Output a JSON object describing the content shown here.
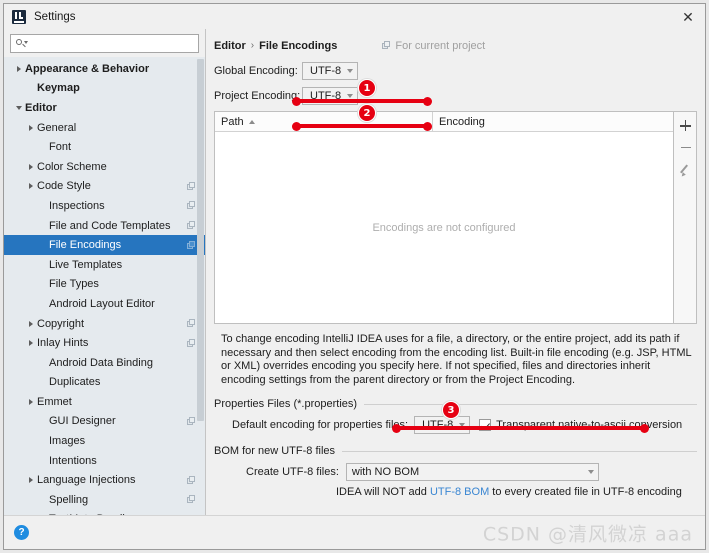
{
  "window": {
    "title": "Settings",
    "app_icon": "intellij-idea-icon",
    "close_label": "✕"
  },
  "sidebar": {
    "search": {
      "placeholder": "",
      "value": "",
      "icon": "search-icon"
    },
    "items": [
      {
        "label": "Appearance & Behavior",
        "arrow": "right",
        "bold": true,
        "indent": 0,
        "project": false,
        "selected": false
      },
      {
        "label": "Keymap",
        "arrow": "none",
        "bold": true,
        "indent": 1,
        "project": false,
        "selected": false
      },
      {
        "label": "Editor",
        "arrow": "down",
        "bold": true,
        "indent": 0,
        "project": false,
        "selected": false
      },
      {
        "label": "General",
        "arrow": "right",
        "bold": false,
        "indent": 1,
        "project": false,
        "selected": false
      },
      {
        "label": "Font",
        "arrow": "none",
        "bold": false,
        "indent": 2,
        "project": false,
        "selected": false
      },
      {
        "label": "Color Scheme",
        "arrow": "right",
        "bold": false,
        "indent": 1,
        "project": false,
        "selected": false
      },
      {
        "label": "Code Style",
        "arrow": "right",
        "bold": false,
        "indent": 1,
        "project": true,
        "selected": false
      },
      {
        "label": "Inspections",
        "arrow": "none",
        "bold": false,
        "indent": 2,
        "project": true,
        "selected": false
      },
      {
        "label": "File and Code Templates",
        "arrow": "none",
        "bold": false,
        "indent": 2,
        "project": true,
        "selected": false
      },
      {
        "label": "File Encodings",
        "arrow": "none",
        "bold": false,
        "indent": 2,
        "project": true,
        "selected": true
      },
      {
        "label": "Live Templates",
        "arrow": "none",
        "bold": false,
        "indent": 2,
        "project": false,
        "selected": false
      },
      {
        "label": "File Types",
        "arrow": "none",
        "bold": false,
        "indent": 2,
        "project": false,
        "selected": false
      },
      {
        "label": "Android Layout Editor",
        "arrow": "none",
        "bold": false,
        "indent": 2,
        "project": false,
        "selected": false
      },
      {
        "label": "Copyright",
        "arrow": "right",
        "bold": false,
        "indent": 1,
        "project": true,
        "selected": false
      },
      {
        "label": "Inlay Hints",
        "arrow": "right",
        "bold": false,
        "indent": 1,
        "project": true,
        "selected": false
      },
      {
        "label": "Android Data Binding",
        "arrow": "none",
        "bold": false,
        "indent": 2,
        "project": false,
        "selected": false
      },
      {
        "label": "Duplicates",
        "arrow": "none",
        "bold": false,
        "indent": 2,
        "project": false,
        "selected": false
      },
      {
        "label": "Emmet",
        "arrow": "right",
        "bold": false,
        "indent": 1,
        "project": false,
        "selected": false
      },
      {
        "label": "GUI Designer",
        "arrow": "none",
        "bold": false,
        "indent": 2,
        "project": true,
        "selected": false
      },
      {
        "label": "Images",
        "arrow": "none",
        "bold": false,
        "indent": 2,
        "project": false,
        "selected": false
      },
      {
        "label": "Intentions",
        "arrow": "none",
        "bold": false,
        "indent": 2,
        "project": false,
        "selected": false
      },
      {
        "label": "Language Injections",
        "arrow": "right",
        "bold": false,
        "indent": 1,
        "project": true,
        "selected": false
      },
      {
        "label": "Spelling",
        "arrow": "none",
        "bold": false,
        "indent": 2,
        "project": true,
        "selected": false
      },
      {
        "label": "TextMate Bundles",
        "arrow": "none",
        "bold": false,
        "indent": 2,
        "project": false,
        "selected": false
      }
    ]
  },
  "main": {
    "breadcrumb": {
      "parent": "Editor",
      "separator": "›",
      "current": "File Encodings"
    },
    "for_current_project": "For current project",
    "global_encoding": {
      "label": "Global Encoding:",
      "value": "UTF-8"
    },
    "project_encoding": {
      "label": "Project Encoding:",
      "value": "UTF-8"
    },
    "table": {
      "columns": [
        "Path",
        "Encoding"
      ],
      "sort_column": "Path",
      "sort_direction": "asc",
      "empty_text": "Encodings are not configured",
      "rows": [],
      "tools": [
        "add",
        "remove",
        "edit"
      ]
    },
    "description": "To change encoding IntelliJ IDEA uses for a file, a directory, or the entire project, add its path if necessary and then select encoding from the encoding list. Built-in file encoding (e.g. JSP, HTML or XML) overrides encoding you specify here. If not specified, files and directories inherit encoding settings from the parent directory or from the Project Encoding.",
    "properties_group": {
      "title": "Properties Files (*.properties)",
      "default_encoding_label": "Default encoding for properties files:",
      "default_encoding_value": "UTF-8",
      "transparent_label": "Transparent native-to-ascii conversion",
      "transparent_checked": true
    },
    "bom_group": {
      "title": "BOM for new UTF-8 files",
      "create_label": "Create UTF-8 files:",
      "create_value": "with NO BOM",
      "hint_prefix": "IDEA will NOT add ",
      "hint_link": "UTF-8 BOM",
      "hint_suffix": " to every created file in UTF-8 encoding"
    }
  },
  "annotations": {
    "badge1": "1",
    "badge2": "2",
    "badge3": "3",
    "color": "#e60012"
  },
  "footer": {
    "help_icon": "?",
    "watermark": "CSDN @清风微凉 aaa"
  }
}
